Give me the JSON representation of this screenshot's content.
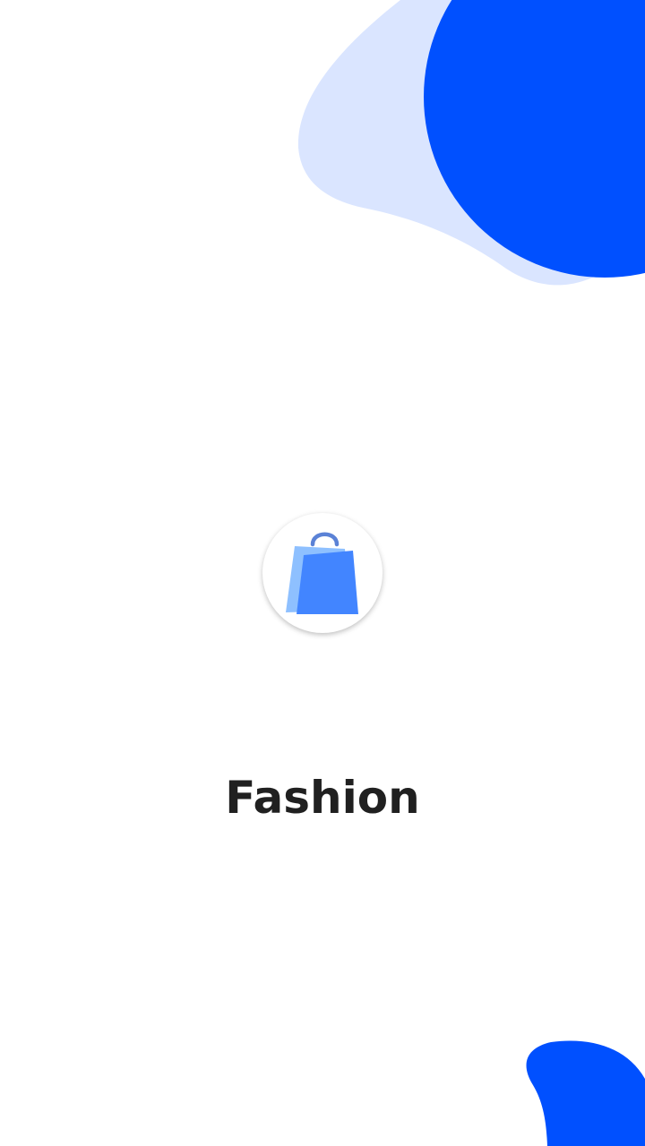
{
  "app": {
    "name": "Fashion"
  },
  "logo": {
    "icon": "shopping-bag-icon"
  },
  "colors": {
    "primary": "#0050FF",
    "primary_light": "#DAE5FF",
    "bag_front": "#4285FF",
    "bag_back": "#8EC0FF",
    "bag_handle": "#5B82D6",
    "text": "#202020",
    "background": "#FFFFFF"
  }
}
